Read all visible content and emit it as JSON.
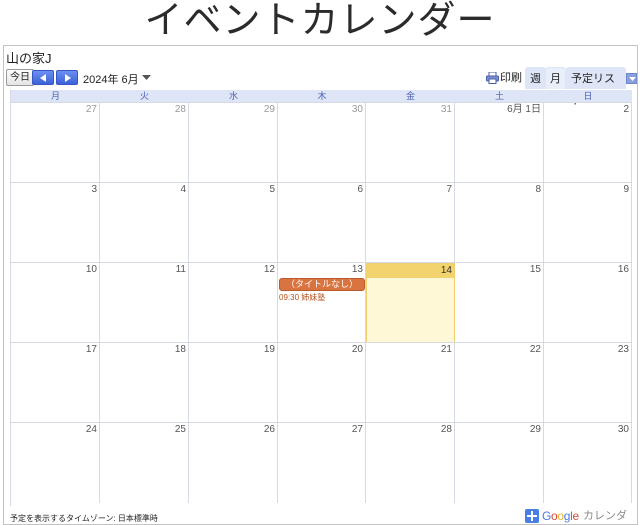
{
  "page": {
    "title": "イベントカレンダー"
  },
  "calendar": {
    "name": "山の家J",
    "today_label": "今日",
    "current_date": "2024年 6月",
    "print_label": "印刷",
    "views": {
      "week": "週",
      "month": "月",
      "agenda": "予定リスト"
    },
    "weekdays": [
      "月",
      "火",
      "水",
      "木",
      "金",
      "土",
      "日"
    ],
    "weeks": [
      [
        {
          "d": "27",
          "o": true
        },
        {
          "d": "28",
          "o": true
        },
        {
          "d": "29",
          "o": true
        },
        {
          "d": "30",
          "o": true
        },
        {
          "d": "31",
          "o": true
        },
        {
          "d": "6月 1日",
          "o": false
        },
        {
          "d": "2",
          "o": false
        }
      ],
      [
        {
          "d": "3",
          "o": false
        },
        {
          "d": "4",
          "o": false
        },
        {
          "d": "5",
          "o": false
        },
        {
          "d": "6",
          "o": false
        },
        {
          "d": "7",
          "o": false
        },
        {
          "d": "8",
          "o": false
        },
        {
          "d": "9",
          "o": false
        }
      ],
      [
        {
          "d": "10",
          "o": false
        },
        {
          "d": "11",
          "o": false
        },
        {
          "d": "12",
          "o": false
        },
        {
          "d": "13",
          "o": false
        },
        {
          "d": "14",
          "o": false,
          "today": true
        },
        {
          "d": "15",
          "o": false
        },
        {
          "d": "16",
          "o": false
        }
      ],
      [
        {
          "d": "17",
          "o": false
        },
        {
          "d": "18",
          "o": false
        },
        {
          "d": "19",
          "o": false
        },
        {
          "d": "20",
          "o": false
        },
        {
          "d": "21",
          "o": false
        },
        {
          "d": "22",
          "o": false
        },
        {
          "d": "23",
          "o": false
        }
      ],
      [
        {
          "d": "24",
          "o": false
        },
        {
          "d": "25",
          "o": false
        },
        {
          "d": "26",
          "o": false
        },
        {
          "d": "27",
          "o": false
        },
        {
          "d": "28",
          "o": false
        },
        {
          "d": "29",
          "o": false
        },
        {
          "d": "30",
          "o": false
        }
      ]
    ],
    "events": {
      "pill_text": "（タイトルなし）",
      "line_text": "09:30 姉妹塾"
    },
    "footer": {
      "timezone": "予定を表示するタイムゾーン: 日本標準時",
      "badge_text": "カレンダー"
    }
  },
  "colors": {
    "accent": "#3b63d8",
    "tab_bg": "#dde5f7",
    "today_bg": "#fff8d6",
    "today_bar": "#f2d36d",
    "event": "#d9733f"
  }
}
